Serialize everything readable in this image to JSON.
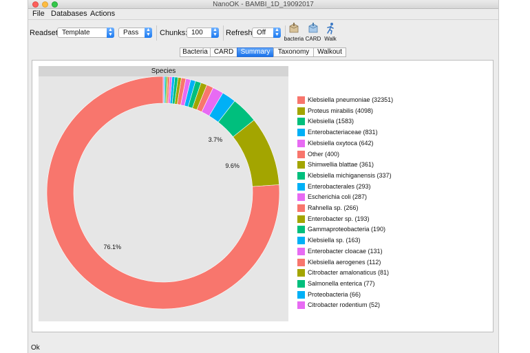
{
  "window": {
    "title": "NanoOK - BAMBI_1D_19092017"
  },
  "menu": [
    "File",
    "Databases",
    "Actions"
  ],
  "toolbar": {
    "readset_label": "Readset:",
    "readset_value": "Template",
    "pass_value": "Pass",
    "chunks_label": "Chunks:",
    "chunks_value": "100",
    "refresh_label": "Refresh:",
    "refresh_value": "Off",
    "buttons": [
      {
        "label": "bacteria",
        "icon": "bacteria-db-icon"
      },
      {
        "label": "CARD",
        "icon": "card-db-icon"
      },
      {
        "label": "Walk",
        "icon": "walk-icon"
      }
    ]
  },
  "tabs": [
    {
      "label": "Bacteria",
      "active": false
    },
    {
      "label": "CARD",
      "active": false
    },
    {
      "label": "Summary",
      "active": true
    },
    {
      "label": "Taxonomy",
      "active": false
    },
    {
      "label": "Walkout",
      "active": false
    }
  ],
  "chart_data": {
    "type": "pie",
    "title": "Species",
    "labels": [
      "Klebsiella pneumoniae",
      "Proteus mirabilis",
      "Klebsiella",
      "Enterobacteriaceae",
      "Klebsiella oxytoca",
      "Other",
      "Shimwellia blattae",
      "Klebsiella michiganensis",
      "Enterobacterales",
      "Escherichia coli",
      "Rahnella sp.",
      "Enterobacter sp.",
      "Gammaproteobacteria",
      "Klebsiella sp.",
      "Enterobacter cloacae",
      "Klebsiella aerogenes",
      "Citrobacter amalonaticus",
      "Salmonella enterica",
      "Proteobacteria",
      "Citrobacter rodentium"
    ],
    "values": [
      32351,
      4098,
      1583,
      831,
      642,
      400,
      361,
      337,
      293,
      287,
      266,
      193,
      190,
      163,
      131,
      112,
      81,
      77,
      66,
      52
    ],
    "legend_entries": [
      "Klebsiella pneumoniae (32351)",
      "Proteus mirabilis (4098)",
      "Klebsiella (1583)",
      "Enterobacteriaceae (831)",
      "Klebsiella oxytoca (642)",
      "Other (400)",
      "Shimwellia blattae (361)",
      "Klebsiella michiganensis (337)",
      "Enterobacterales (293)",
      "Escherichia coli (287)",
      "Rahnella sp. (266)",
      "Enterobacter sp. (193)",
      "Gammaproteobacteria (190)",
      "Klebsiella sp. (163)",
      "Enterobacter cloacae (131)",
      "Klebsiella aerogenes (112)",
      "Citrobacter amalonaticus (81)",
      "Salmonella enterica (77)",
      "Proteobacteria (66)",
      "Citrobacter rodentium (52)"
    ],
    "colors": [
      "#f8766d",
      "#a3a500",
      "#00bf7d",
      "#00b0f6",
      "#e76bf3"
    ],
    "percent_labels": [
      "76.1%",
      "9.6%",
      "3.7%"
    ],
    "legend_position": "right",
    "hole": true
  },
  "status": {
    "text": "Ok"
  }
}
